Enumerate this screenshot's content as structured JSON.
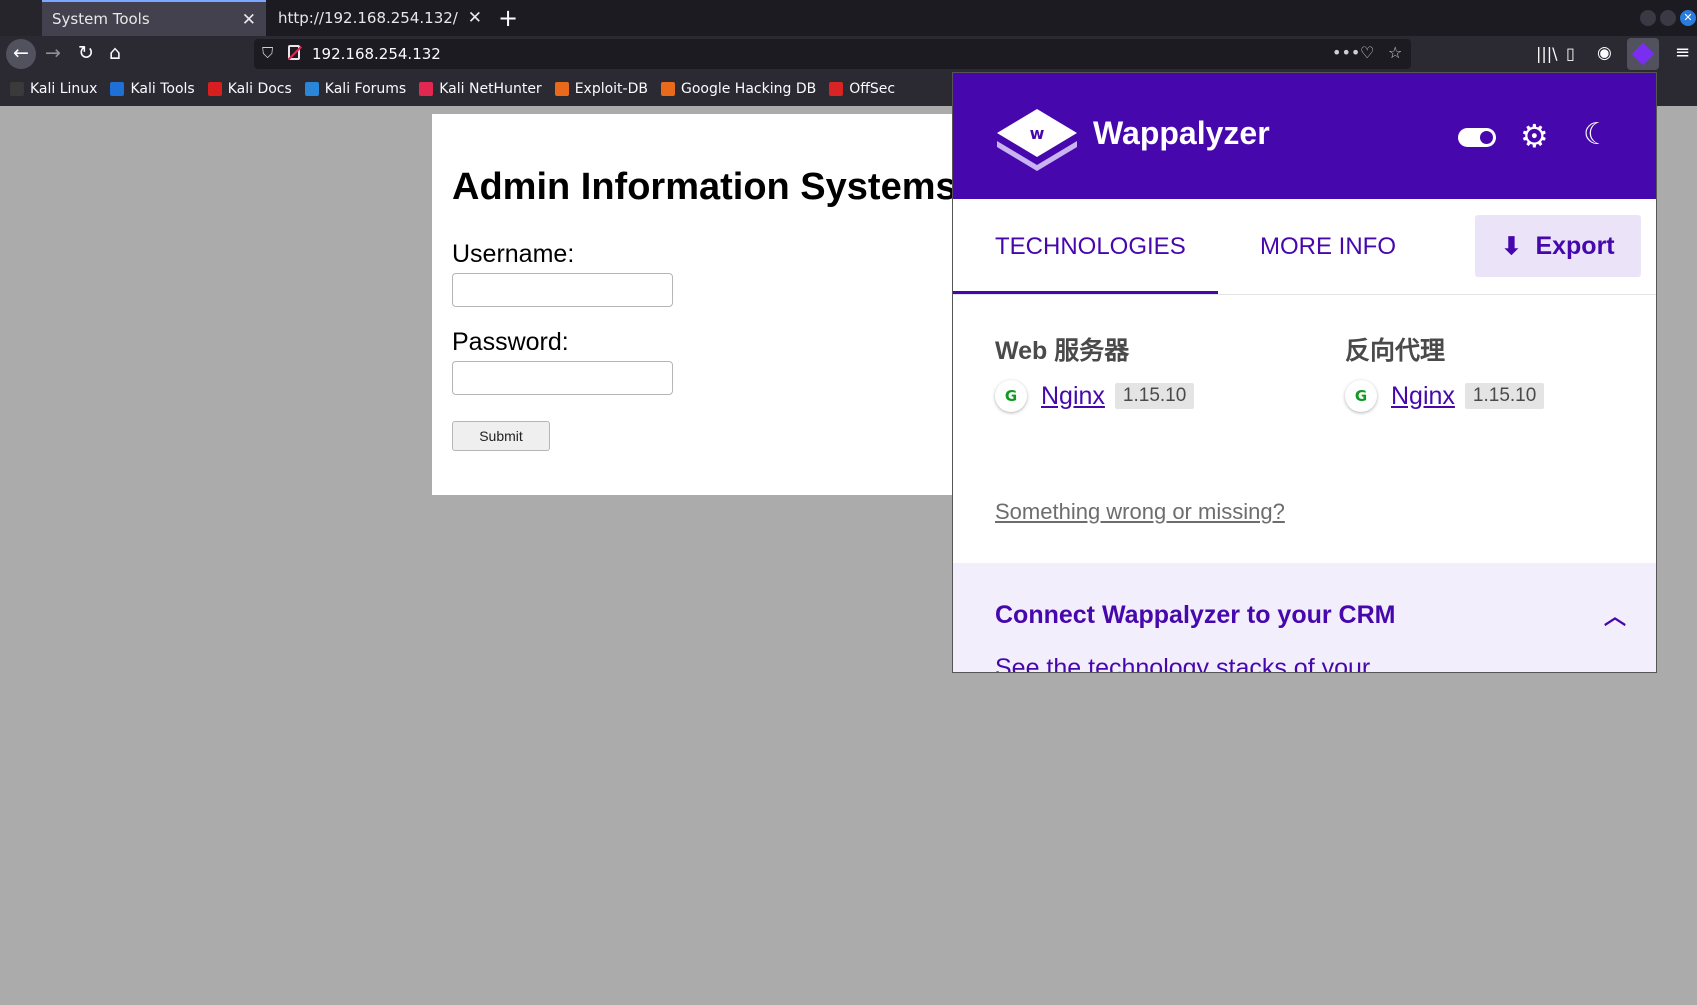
{
  "browser": {
    "tabs": [
      {
        "title": "System Tools"
      },
      {
        "title": "http://192.168.254.132/"
      }
    ],
    "url": "192.168.254.132",
    "bookmarks": [
      {
        "label": "Kali Linux",
        "color": "#3a3a3a"
      },
      {
        "label": "Kali Tools",
        "color": "#1e6fd6"
      },
      {
        "label": "Kali Docs",
        "color": "#d81e1e"
      },
      {
        "label": "Kali Forums",
        "color": "#2a86d8"
      },
      {
        "label": "Kali NetHunter",
        "color": "#e22850"
      },
      {
        "label": "Exploit-DB",
        "color": "#e86a1a"
      },
      {
        "label": "Google Hacking DB",
        "color": "#e86a1a"
      },
      {
        "label": "OffSec",
        "color": "#d82424"
      }
    ]
  },
  "page": {
    "heading": "Admin Information Systems",
    "username_label": "Username:",
    "username_value": "",
    "password_label": "Password:",
    "password_value": "",
    "submit_label": "Submit"
  },
  "wappalyzer": {
    "brand": "Wappalyzer",
    "brand_color": "#4608ad",
    "tabs": [
      "TECHNOLOGIES",
      "MORE INFO"
    ],
    "export_label": "Export",
    "categories": [
      {
        "title": "Web 服务器",
        "tech": {
          "name": "Nginx",
          "version": "1.15.10",
          "icon": "nginx-icon"
        }
      },
      {
        "title": "反向代理",
        "tech": {
          "name": "Nginx",
          "version": "1.15.10",
          "icon": "nginx-icon"
        }
      }
    ],
    "feedback_link": "Something wrong or missing?",
    "crm": {
      "title": "Connect Wappalyzer to your CRM",
      "text": "See the technology stacks of your"
    }
  }
}
